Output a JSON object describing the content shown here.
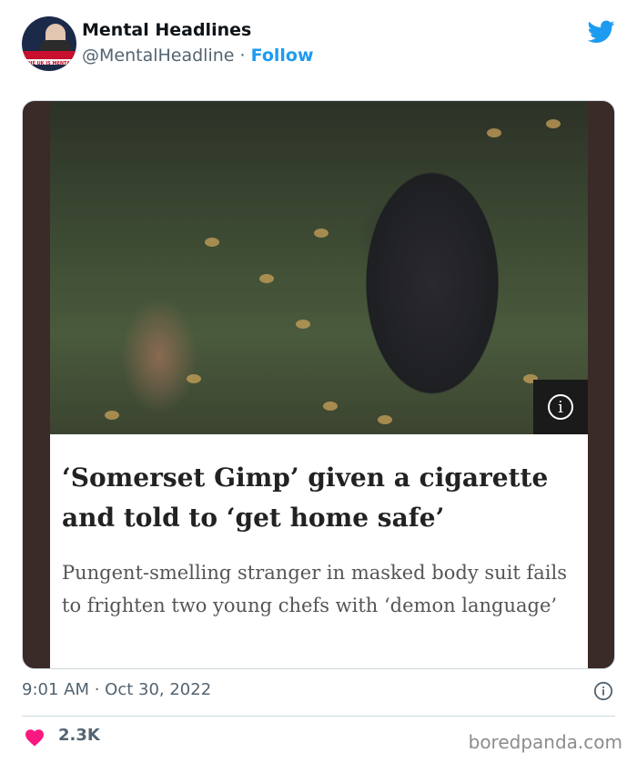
{
  "author": {
    "display_name": "Mental Headlines",
    "handle": "@MentalHeadline",
    "separator": "·",
    "follow_label": "Follow",
    "avatar_caption": "THE UK IS MENTAL"
  },
  "article": {
    "headline": "‘Somerset Gimp’ given a cigarette and told to ‘get home safe’",
    "standfirst": "Pungent-smelling stranger in masked body suit fails to frighten two young chefs with ‘demon language’",
    "info_glyph": "i"
  },
  "meta": {
    "timestamp": "9:01 AM · Oct 30, 2022",
    "likes": "2.3K"
  },
  "watermark": "boredpanda.com",
  "icons": {
    "brand": "twitter-bird-icon",
    "info": "info-icon",
    "like": "heart-icon"
  },
  "colors": {
    "twitter_blue": "#1d9bf0",
    "heart_red": "#f91880",
    "muted_text": "#536471",
    "card_side": "#3a2a28"
  }
}
